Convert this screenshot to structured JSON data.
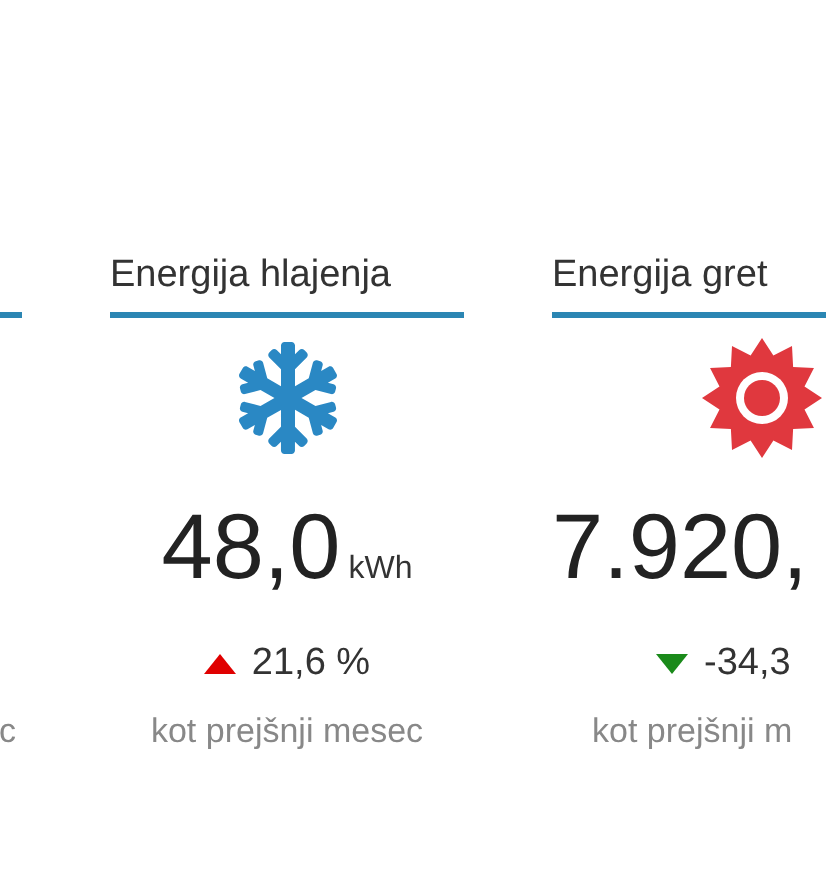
{
  "cards": [
    {
      "sub": "c"
    },
    {
      "kind": "cooling",
      "title": "Energija hlajenja",
      "value": "48,0",
      "unit": "kWh",
      "change": "21,6 %",
      "rising": true,
      "sub": "kot prejšnji mesec"
    },
    {
      "kind": "heating",
      "title": "Energija gret",
      "value": "7.920,",
      "change": "-34,3",
      "rising": false,
      "sub": "kot prejšnji m"
    }
  ]
}
